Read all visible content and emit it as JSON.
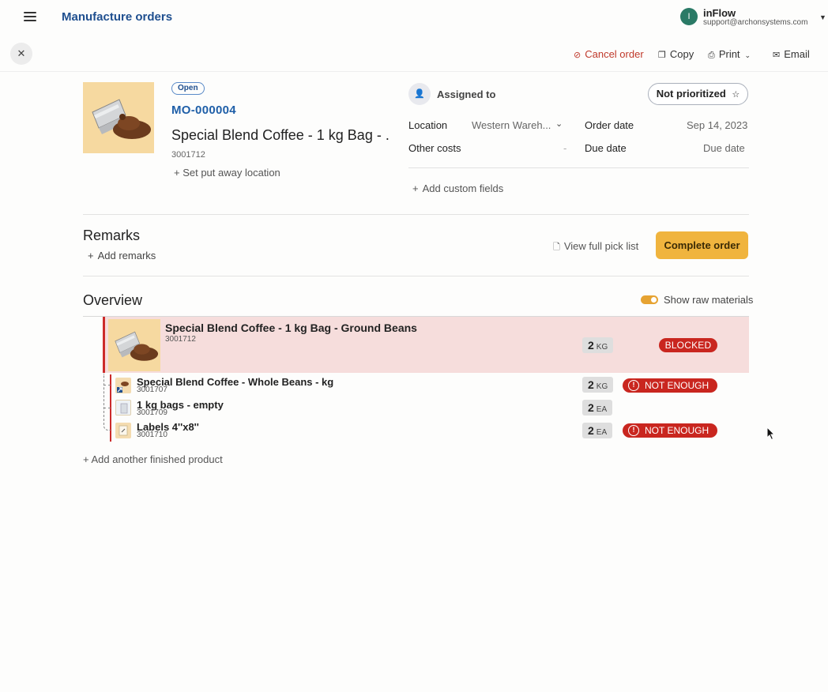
{
  "header": {
    "title": "Manufacture orders",
    "account": {
      "initial": "I",
      "name": "inFlow",
      "email": "support@archonsystems.com"
    }
  },
  "actions": {
    "cancel": "Cancel order",
    "copy": "Copy",
    "print": "Print",
    "email": "Email"
  },
  "order": {
    "status": "Open",
    "number": "MO-000004",
    "product_name": "Special Blend Coffee - 1 kg Bag - ...",
    "product_sku": "3001712",
    "put_away": "+ Set put away location",
    "assigned_to": "Assigned to",
    "priority": "Not prioritized",
    "fields": {
      "location_label": "Location",
      "location_value": "Western Wareh...",
      "other_costs_label": "Other costs",
      "other_costs_value": "-",
      "order_date_label": "Order date",
      "order_date_value": "Sep 14, 2023",
      "due_date_label": "Due date",
      "due_date_value": "Due date"
    },
    "add_custom_fields": "Add custom fields"
  },
  "remarks": {
    "title": "Remarks",
    "add": "Add remarks",
    "pick_list": "View full pick list",
    "complete": "Complete order"
  },
  "overview": {
    "title": "Overview",
    "toggle_label": "Show raw materials",
    "finished_product": {
      "name": "Special Blend Coffee - 1 kg Bag - Ground Beans",
      "sku": "3001712",
      "qty": "2",
      "unit": "KG",
      "status": "BLOCKED"
    },
    "raw_materials": [
      {
        "name": "Special Blend Coffee - Whole Beans - kg",
        "sku": "3001707",
        "qty": "2",
        "unit": "KG",
        "status": "NOT ENOUGH"
      },
      {
        "name": "1 kg bags - empty",
        "sku": "3001709",
        "qty": "2",
        "unit": "EA",
        "status": ""
      },
      {
        "name": "Labels 4''x8''",
        "sku": "3001710",
        "qty": "2",
        "unit": "EA",
        "status": "NOT ENOUGH"
      }
    ],
    "add_finished": "+ Add another finished product"
  }
}
